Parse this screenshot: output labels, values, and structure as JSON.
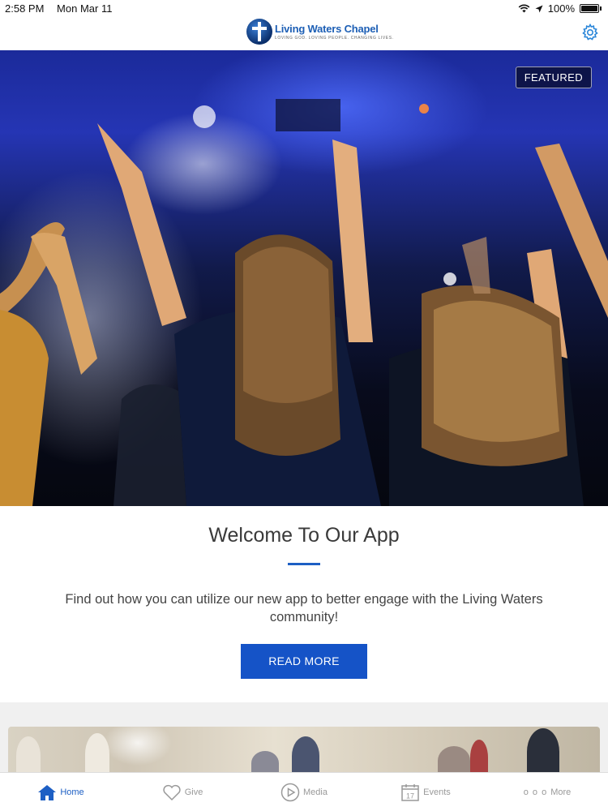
{
  "status_bar": {
    "time": "2:58 PM",
    "date": "Mon Mar 11",
    "battery": "100%",
    "icons": [
      "wifi-icon",
      "location-arrow-icon",
      "battery-icon"
    ]
  },
  "header": {
    "logo_name": "Living Waters Chapel",
    "logo_tagline": "LOVING GOD. LOVING PEOPLE. CHANGING LIVES.",
    "settings_icon": "gear-icon",
    "accent_color": "#1d5fb5"
  },
  "hero": {
    "badge": "FEATURED"
  },
  "welcome": {
    "title": "Welcome To Our App",
    "description": "Find out how you can utilize our new app to better engage with the Living Waters community!",
    "button_label": "READ MORE",
    "button_color": "#1553c7"
  },
  "tab_bar": {
    "tabs": [
      {
        "label": "Home",
        "icon": "home-icon",
        "active": true
      },
      {
        "label": "Give",
        "icon": "heart-icon",
        "active": false
      },
      {
        "label": "Media",
        "icon": "play-icon",
        "active": false
      },
      {
        "label": "Events",
        "icon": "calendar-icon",
        "active": false,
        "icon_text": "17"
      },
      {
        "label": "More",
        "icon": "more-icon",
        "active": false,
        "icon_text": "o o o"
      }
    ]
  }
}
